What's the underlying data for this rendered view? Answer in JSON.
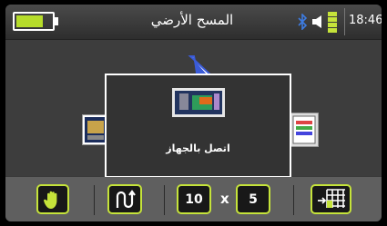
{
  "header": {
    "title": "المسح الأرضي",
    "time": "18:46",
    "battery_level": 0.75,
    "battery_color": "#b6dc2a",
    "icons": [
      "battery-icon",
      "bluetooth-icon",
      "speaker-icon",
      "signal-icon"
    ]
  },
  "dialog": {
    "message": "اتصل بالجهاز",
    "icon": "device-connect-icon"
  },
  "footer": {
    "grid_x": "10",
    "grid_separator": "x",
    "grid_y": "5",
    "icons": [
      "hand-icon",
      "scan-path-icon",
      "grid-settings-icon"
    ],
    "accent_color": "#c5e33a"
  }
}
